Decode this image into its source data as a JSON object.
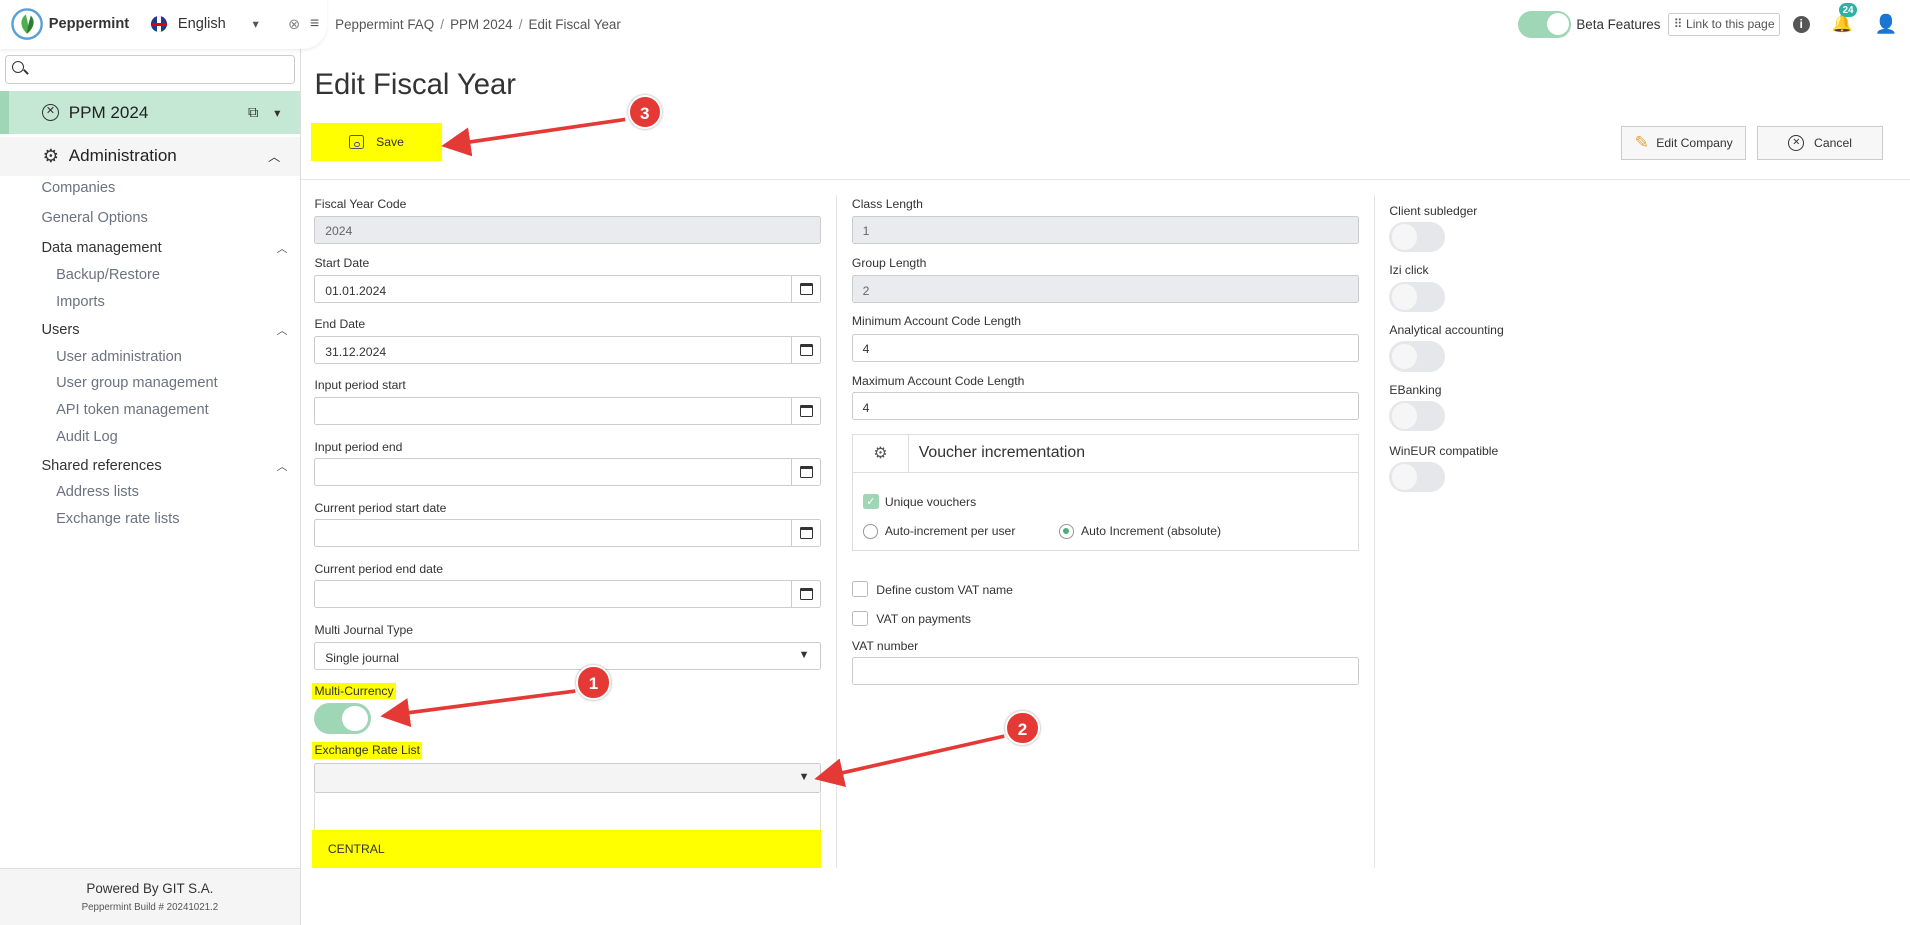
{
  "app": {
    "name": "Peppermint",
    "language": "English"
  },
  "sidebar": {
    "search_placeholder": "",
    "project": "PPM 2024",
    "section": "Administration",
    "companies": "Companies",
    "general_options": "General Options",
    "data_management": {
      "label": "Data management",
      "items": [
        "Backup/Restore",
        "Imports"
      ]
    },
    "users": {
      "label": "Users",
      "items": [
        "User administration",
        "User group management",
        "API token management",
        "Audit Log"
      ]
    },
    "shared_references": {
      "label": "Shared references",
      "items": [
        "Address lists",
        "Exchange rate lists"
      ]
    },
    "footer": {
      "powered": "Powered By GIT S.A.",
      "build": "Peppermint Build # 20241021.2"
    }
  },
  "breadcrumb": [
    "Peppermint FAQ",
    "PPM 2024",
    "Edit Fiscal Year"
  ],
  "topbar": {
    "beta": "Beta Features",
    "link": "⠿ Link to this page",
    "notifications": "24"
  },
  "page": {
    "title": "Edit Fiscal Year",
    "save": "Save",
    "edit_company": "Edit Company",
    "cancel": "Cancel"
  },
  "form": {
    "fiscal_year_code": {
      "label": "Fiscal Year Code",
      "value": "2024"
    },
    "start_date": {
      "label": "Start Date",
      "value": "01.01.2024"
    },
    "end_date": {
      "label": "End Date",
      "value": "31.12.2024"
    },
    "input_period_start": {
      "label": "Input period start",
      "value": ""
    },
    "input_period_end": {
      "label": "Input period end",
      "value": ""
    },
    "current_period_start": {
      "label": "Current period start date",
      "value": ""
    },
    "current_period_end": {
      "label": "Current period end date",
      "value": ""
    },
    "multi_journal_type": {
      "label": "Multi Journal Type",
      "value": "Single journal"
    },
    "multi_currency": {
      "label": "Multi-Currency",
      "enabled": true
    },
    "exchange_rate_list": {
      "label": "Exchange Rate List",
      "value": "",
      "option": "CENTRAL"
    },
    "class_length": {
      "label": "Class Length",
      "value": "1"
    },
    "group_length": {
      "label": "Group Length",
      "value": "2"
    },
    "min_account_code": {
      "label": "Minimum Account Code Length",
      "value": "4"
    },
    "max_account_code": {
      "label": "Maximum Account Code Length",
      "value": "4"
    },
    "voucher": {
      "title": "Voucher incrementation",
      "unique": "Unique vouchers",
      "auto_per_user": "Auto-increment per user",
      "auto_absolute": "Auto Increment (absolute)"
    },
    "custom_vat": "Define custom VAT name",
    "vat_payments": "VAT on payments",
    "vat_number": {
      "label": "VAT number",
      "value": ""
    },
    "switches": [
      "Client subledger",
      "Izi click",
      "Analytical accounting",
      "EBanking",
      "WinEUR compatible"
    ]
  },
  "annotations": [
    "1",
    "2",
    "3"
  ],
  "colors": {
    "accent": "#9fd6b5",
    "highlight": "#ffff00",
    "marker": "#e53935"
  }
}
